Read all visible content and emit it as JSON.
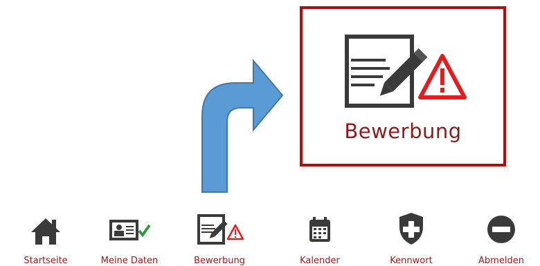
{
  "zoom": {
    "label": "Bewerbung",
    "icons": [
      "application-form-pencil-icon",
      "warning-triangle-icon"
    ],
    "accent": "#b00d0d"
  },
  "annotation": {
    "arrow": "callout-arrow",
    "color": "#5b9bd5"
  },
  "toolbar": {
    "items": [
      {
        "label": "Startseite",
        "icon": "home-icon"
      },
      {
        "label": "Meine Daten",
        "icon": "id-card-check-icon"
      },
      {
        "label": "Bewerbung",
        "icon": "application-form-warning-icon"
      },
      {
        "label": "Kalender",
        "icon": "calendar-icon"
      },
      {
        "label": "Kennwort",
        "icon": "shield-plus-icon"
      },
      {
        "label": "Abmelden",
        "icon": "minus-circle-icon"
      }
    ],
    "label_color": "#a01a1a",
    "icon_color": "#3a3a3a"
  }
}
